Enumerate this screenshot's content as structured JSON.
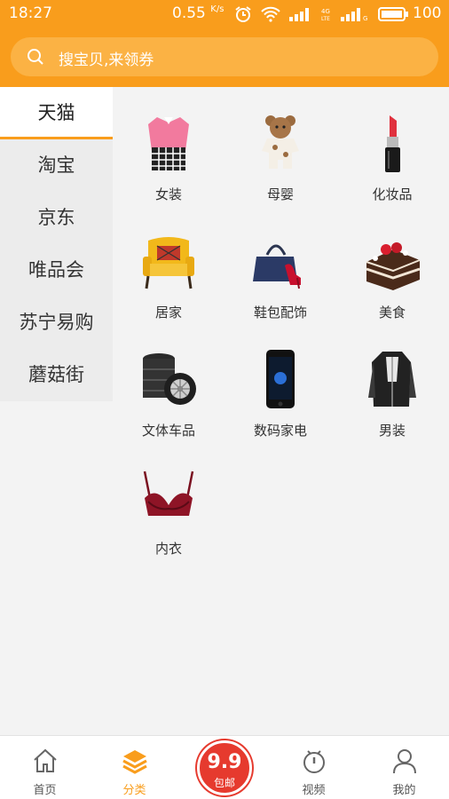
{
  "status_bar": {
    "time": "18:27",
    "speed": "0.55",
    "speed_unit": "K/s",
    "battery": "100",
    "icons": [
      "alarm-icon",
      "wifi-icon",
      "signal-icon",
      "signal-4g-icon",
      "signal-icon",
      "battery-icon"
    ]
  },
  "search": {
    "placeholder": "搜宝贝,来领券",
    "icon": "search-icon"
  },
  "sidebar": {
    "items": [
      {
        "label": "天猫",
        "active": true
      },
      {
        "label": "淘宝"
      },
      {
        "label": "京东"
      },
      {
        "label": "唯品会"
      },
      {
        "label": "苏宁易购"
      },
      {
        "label": "蘑菇街"
      }
    ]
  },
  "categories": [
    {
      "label": "女装",
      "icon": "womens-clothing-icon"
    },
    {
      "label": "母婴",
      "icon": "baby-icon"
    },
    {
      "label": "化妆品",
      "icon": "lipstick-icon"
    },
    {
      "label": "居家",
      "icon": "armchair-icon"
    },
    {
      "label": "鞋包配饰",
      "icon": "bag-shoe-icon"
    },
    {
      "label": "美食",
      "icon": "cake-icon"
    },
    {
      "label": "文体车品",
      "icon": "tire-icon"
    },
    {
      "label": "数码家电",
      "icon": "phone-icon"
    },
    {
      "label": "男装",
      "icon": "mens-jacket-icon"
    },
    {
      "label": "内衣",
      "icon": "lingerie-icon"
    }
  ],
  "bottom_nav": {
    "items": [
      {
        "label": "首页",
        "icon": "home-icon"
      },
      {
        "label": "分类",
        "icon": "category-layers-icon",
        "active": true
      },
      {
        "label": "视频",
        "icon": "video-icon"
      },
      {
        "label": "我的",
        "icon": "profile-icon"
      }
    ],
    "promo": {
      "value": "9.9",
      "label": "包邮"
    }
  },
  "colors": {
    "accent": "#f99d1c",
    "promo": "#e63a2e"
  }
}
